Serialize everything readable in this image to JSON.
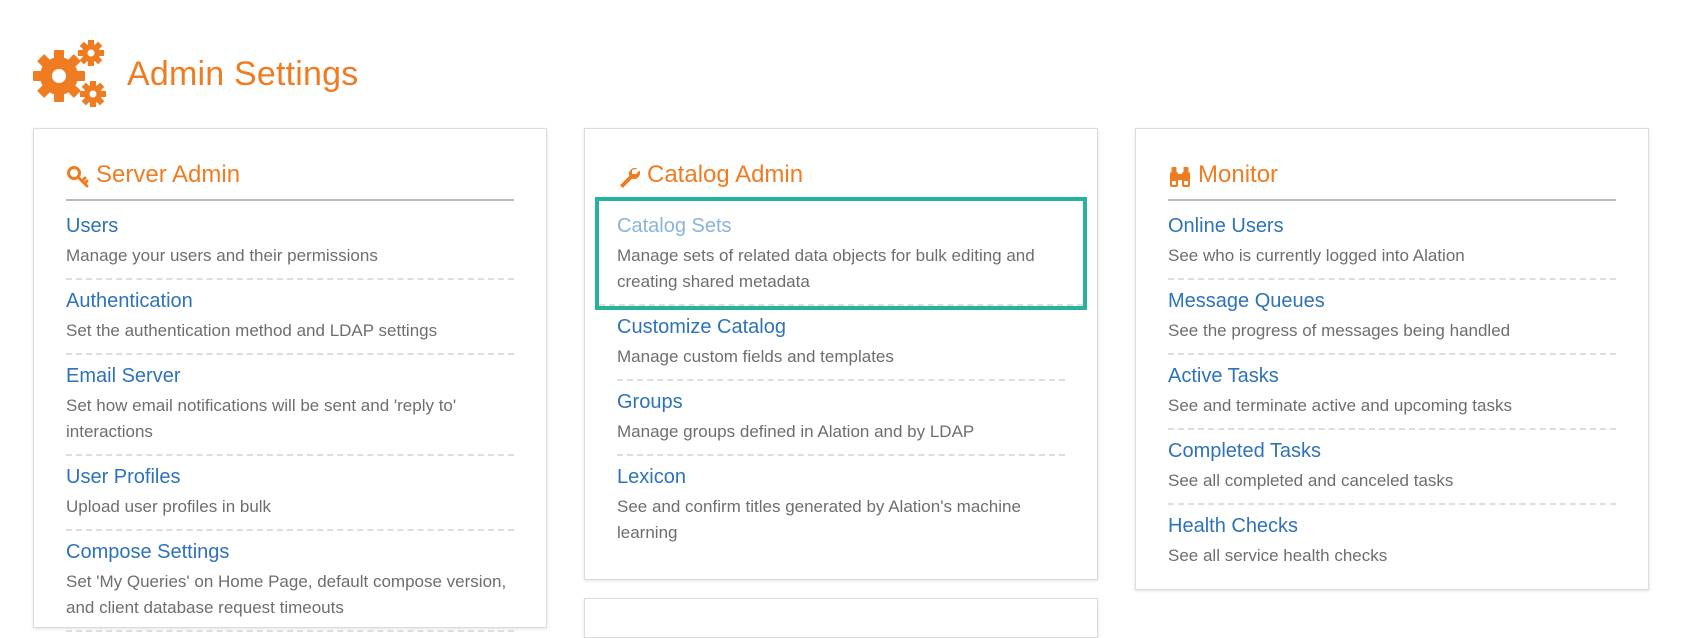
{
  "page": {
    "title": "Admin Settings",
    "icon": "gears-icon",
    "accent_color": "#f07c22",
    "link_color": "#2e73ba",
    "highlight_color": "#26b29d"
  },
  "panels": [
    {
      "title": "Server Admin",
      "icon": "key-icon",
      "items": [
        {
          "title": "Users",
          "desc": "Manage your users and their permissions"
        },
        {
          "title": "Authentication",
          "desc": "Set the authentication method and LDAP settings"
        },
        {
          "title": "Email Server",
          "desc": "Set how email notifications will be sent and 'reply to' interactions"
        },
        {
          "title": "User Profiles",
          "desc": "Upload user profiles in bulk"
        },
        {
          "title": "Compose Settings",
          "desc": "Set 'My Queries' on Home Page, default compose version, and client database request timeouts"
        }
      ]
    },
    {
      "title": "Catalog Admin",
      "icon": "wrench-icon",
      "items": [
        {
          "title": "Catalog Sets",
          "desc": "Manage sets of related data objects for bulk editing and creating shared metadata",
          "selected": true
        },
        {
          "title": "Customize Catalog",
          "desc": "Manage custom fields and templates"
        },
        {
          "title": "Groups",
          "desc": "Manage groups defined in Alation and by LDAP"
        },
        {
          "title": "Lexicon",
          "desc": "See and confirm titles generated by Alation's machine learning"
        }
      ]
    },
    {
      "title": "Monitor",
      "icon": "binoculars-icon",
      "items": [
        {
          "title": "Online Users",
          "desc": "See who is currently logged into Alation"
        },
        {
          "title": "Message Queues",
          "desc": "See the progress of messages being handled"
        },
        {
          "title": "Active Tasks",
          "desc": "See and terminate active and upcoming tasks"
        },
        {
          "title": "Completed Tasks",
          "desc": "See all completed and canceled tasks"
        },
        {
          "title": "Health Checks",
          "desc": "See all service health checks"
        }
      ]
    }
  ]
}
